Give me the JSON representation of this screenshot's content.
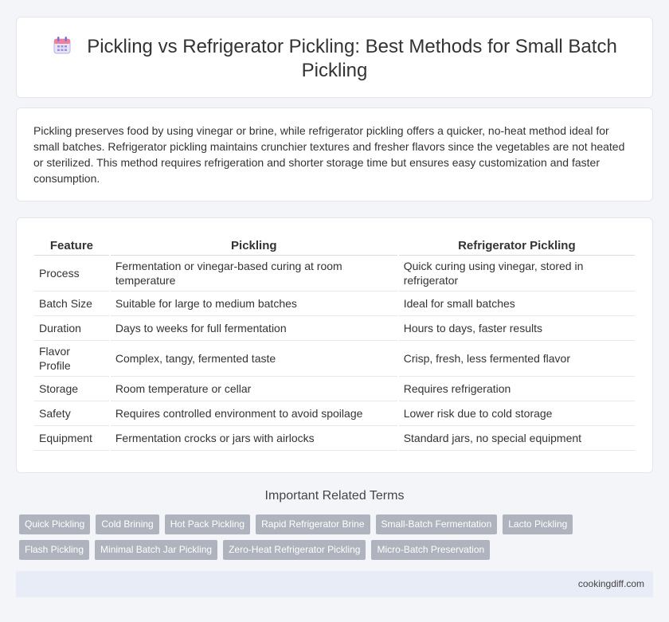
{
  "header": {
    "icon": "calendar-icon",
    "title": "Pickling vs Refrigerator Pickling: Best Methods for Small Batch Pickling"
  },
  "intro": {
    "text": "Pickling preserves food by using vinegar or brine, while refrigerator pickling offers a quicker, no-heat method ideal for small batches. Refrigerator pickling maintains crunchier textures and fresher flavors since the vegetables are not heated or sterilized. This method requires refrigeration and shorter storage time but ensures easy customization and faster consumption."
  },
  "table": {
    "headers": [
      "Feature",
      "Pickling",
      "Refrigerator Pickling"
    ],
    "rows": [
      [
        "Process",
        "Fermentation or vinegar-based curing at room temperature",
        "Quick curing using vinegar, stored in refrigerator"
      ],
      [
        "Batch Size",
        "Suitable for large to medium batches",
        "Ideal for small batches"
      ],
      [
        "Duration",
        "Days to weeks for full fermentation",
        "Hours to days, faster results"
      ],
      [
        "Flavor Profile",
        "Complex, tangy, fermented taste",
        "Crisp, fresh, less fermented flavor"
      ],
      [
        "Storage",
        "Room temperature or cellar",
        "Requires refrigeration"
      ],
      [
        "Safety",
        "Requires controlled environment to avoid spoilage",
        "Lower risk due to cold storage"
      ],
      [
        "Equipment",
        "Fermentation crocks or jars with airlocks",
        "Standard jars, no special equipment"
      ]
    ]
  },
  "related": {
    "title": "Important Related Terms",
    "tags_row1": [
      "Quick Pickling",
      "Cold Brining",
      "Hot Pack Pickling",
      "Rapid Refrigerator Brine",
      "Small-Batch Fermentation",
      "Lacto Pickling"
    ],
    "tags_row2": [
      "Flash Pickling",
      "Minimal Batch Jar Pickling",
      "Zero-Heat Refrigerator Pickling",
      "Micro-Batch Preservation"
    ]
  },
  "footer": {
    "site": "cookingdiff.com"
  },
  "colors": {
    "tag_bg": "#aeb3bd",
    "footer_bg": "#e8ecf6",
    "page_bg": "#f4f5f9"
  }
}
